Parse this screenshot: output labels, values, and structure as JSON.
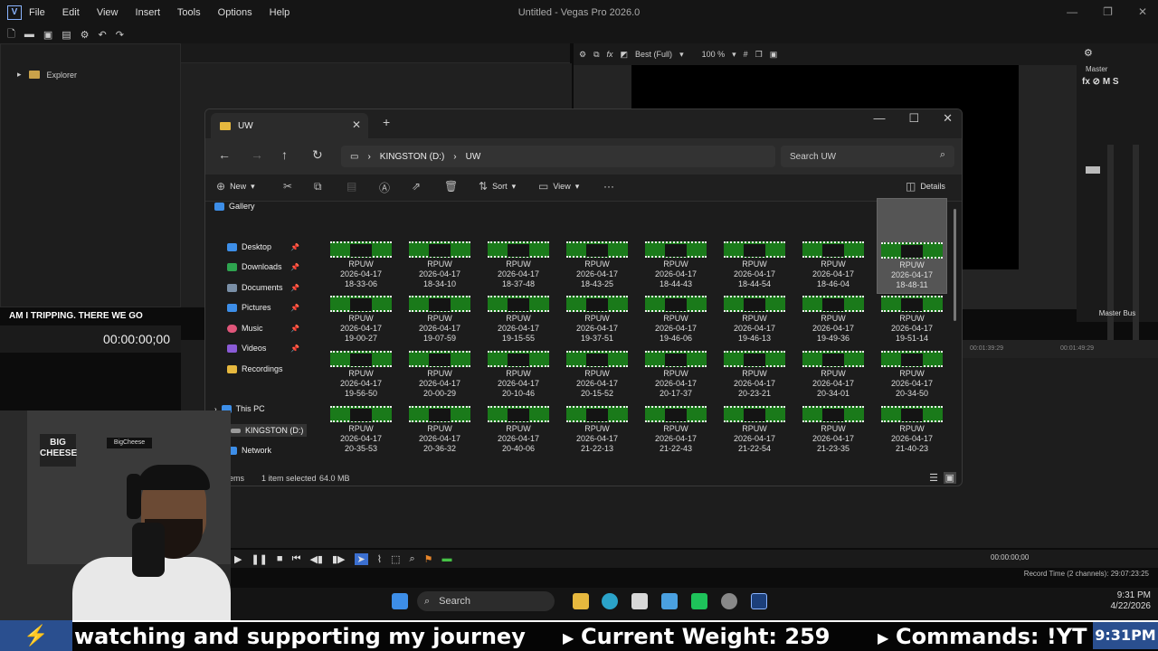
{
  "vegas": {
    "logo": "V",
    "menu": [
      "File",
      "Edit",
      "View",
      "Insert",
      "Tools",
      "Options",
      "Help"
    ],
    "title": "Untitled - Vegas Pro 2026.0",
    "explorer_label": "Explorer",
    "preview_quality": "Best (Full)",
    "preview_zoom": "100 %",
    "master_label": "Master",
    "master_fx": "fx ⊘ M S",
    "master_bus": "Master Bus",
    "caption": "AM I TRIPPING. THERE WE GO",
    "timecode": "00:00:00;00",
    "ruler_marks": [
      "00:01:39:29",
      "00:01:49:29"
    ],
    "transport_time": "00:00:00;00",
    "record_time": "Record Time (2 channels): 29:07:23:25"
  },
  "file_explorer": {
    "tab_title": "UW",
    "path": [
      "KINGSTON (D:)",
      "UW"
    ],
    "search_placeholder": "Search UW",
    "commands": {
      "new": "New",
      "sort": "Sort",
      "view": "View",
      "more": "···",
      "details": "Details"
    },
    "sidebar": {
      "gallery": "Gallery",
      "quick": [
        "Desktop",
        "Downloads",
        "Documents",
        "Pictures",
        "Music",
        "Videos",
        "Recordings"
      ],
      "this_pc": "This PC",
      "drive": "KINGSTON (D:)",
      "network": "Network"
    },
    "files": [
      {
        "name": "RPUW",
        "date": "2026-04-17",
        "time": "18-33-06"
      },
      {
        "name": "RPUW",
        "date": "2026-04-17",
        "time": "18-34-10"
      },
      {
        "name": "RPUW",
        "date": "2026-04-17",
        "time": "18-37-48"
      },
      {
        "name": "RPUW",
        "date": "2026-04-17",
        "time": "18-43-25"
      },
      {
        "name": "RPUW",
        "date": "2026-04-17",
        "time": "18-44-43"
      },
      {
        "name": "RPUW",
        "date": "2026-04-17",
        "time": "18-44-54"
      },
      {
        "name": "RPUW",
        "date": "2026-04-17",
        "time": "18-46-04"
      },
      {
        "name": "RPUW",
        "date": "2026-04-17",
        "time": "18-48-11",
        "selected": true
      },
      {
        "name": "RPUW",
        "date": "2026-04-17",
        "time": "19-00-27"
      },
      {
        "name": "RPUW",
        "date": "2026-04-17",
        "time": "19-07-59"
      },
      {
        "name": "RPUW",
        "date": "2026-04-17",
        "time": "19-15-55"
      },
      {
        "name": "RPUW",
        "date": "2026-04-17",
        "time": "19-37-51"
      },
      {
        "name": "RPUW",
        "date": "2026-04-17",
        "time": "19-46-06"
      },
      {
        "name": "RPUW",
        "date": "2026-04-17",
        "time": "19-46-13"
      },
      {
        "name": "RPUW",
        "date": "2026-04-17",
        "time": "19-49-36"
      },
      {
        "name": "RPUW",
        "date": "2026-04-17",
        "time": "19-51-14"
      },
      {
        "name": "RPUW",
        "date": "2026-04-17",
        "time": "19-56-50"
      },
      {
        "name": "RPUW",
        "date": "2026-04-17",
        "time": "20-00-29"
      },
      {
        "name": "RPUW",
        "date": "2026-04-17",
        "time": "20-10-46"
      },
      {
        "name": "RPUW",
        "date": "2026-04-17",
        "time": "20-15-52"
      },
      {
        "name": "RPUW",
        "date": "2026-04-17",
        "time": "20-17-37"
      },
      {
        "name": "RPUW",
        "date": "2026-04-17",
        "time": "20-23-21"
      },
      {
        "name": "RPUW",
        "date": "2026-04-17",
        "time": "20-34-01"
      },
      {
        "name": "RPUW",
        "date": "2026-04-17",
        "time": "20-34-50"
      },
      {
        "name": "RPUW",
        "date": "2026-04-17",
        "time": "20-35-53"
      },
      {
        "name": "RPUW",
        "date": "2026-04-17",
        "time": "20-36-32"
      },
      {
        "name": "RPUW",
        "date": "2026-04-17",
        "time": "20-40-06"
      },
      {
        "name": "RPUW",
        "date": "2026-04-17",
        "time": "21-22-13"
      },
      {
        "name": "RPUW",
        "date": "2026-04-17",
        "time": "21-22-43"
      },
      {
        "name": "RPUW",
        "date": "2026-04-17",
        "time": "21-22-54"
      },
      {
        "name": "RPUW",
        "date": "2026-04-17",
        "time": "21-23-35"
      },
      {
        "name": "RPUW",
        "date": "2026-04-17",
        "time": "21-40-23"
      }
    ],
    "status": {
      "items": "ems",
      "selected": "1 item selected",
      "size": "64.0 MB"
    }
  },
  "taskbar": {
    "search": "Search",
    "time": "9:31 PM",
    "date": "4/22/2026"
  },
  "ticker": {
    "text1": "watching and supporting my journey",
    "text2": "Current Weight: 259",
    "text3": "Commands: !YT !Y",
    "clock": "9:31PM"
  },
  "webcam": {
    "sign1": "BIG CHEESE",
    "sign2": "BigCheese"
  },
  "colors": {
    "accent": "#4f8fe6",
    "thumb_green": "#1a7a1a",
    "ticker_blue": "#2a4f8f"
  }
}
